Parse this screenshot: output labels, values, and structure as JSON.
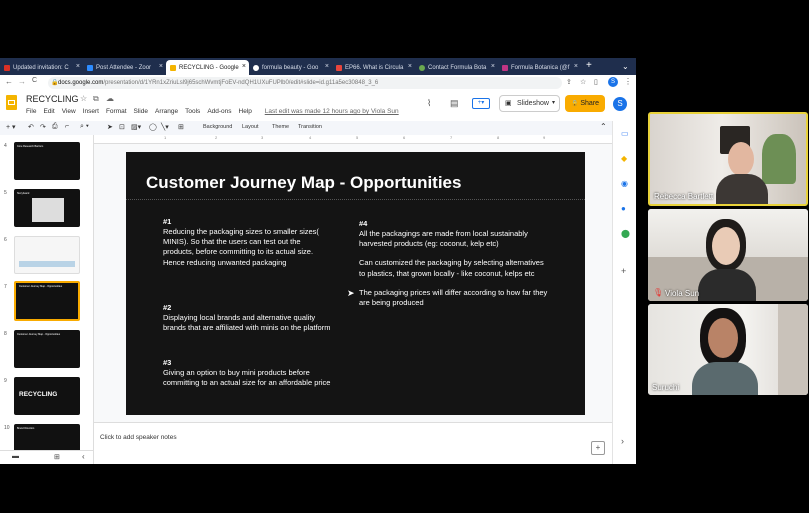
{
  "tabs": [
    {
      "label": "Updated invitation: C",
      "icon_color": "#d93025"
    },
    {
      "label": "Post Attendee - Zoor",
      "icon_color": "#2d8cff"
    },
    {
      "label": "RECYCLING - Google",
      "icon_color": "#f4b400",
      "active": true
    },
    {
      "label": "formula beauty - Goo",
      "icon_color": "#ffffff"
    },
    {
      "label": "EP66. What is Circula",
      "icon_color": "#e8453c"
    },
    {
      "label": "Contact Formula Bota",
      "icon_color": "#6aa84f"
    },
    {
      "label": "Formula Botanica (@f",
      "icon_color": "#c13584"
    }
  ],
  "new_tab_symbol": "+",
  "tab_close_symbol": "×",
  "nav": {
    "back": "←",
    "forward": "→",
    "reload": "C"
  },
  "address": {
    "url_host": "docs.google.com",
    "url_path": "/presentation/d/1YRn1xZriuLsl9j65schWvmtjFoEV-ndQH1UXuFUPlb0/edit#slide=id.g11a5ec30848_3_6"
  },
  "account_initial": "S",
  "doc": {
    "title": "RECYCLING",
    "menu": [
      "File",
      "Edit",
      "View",
      "Insert",
      "Format",
      "Slide",
      "Arrange",
      "Tools",
      "Add-ons",
      "Help"
    ],
    "last_edit": "Last edit was made 12 hours ago by Viola Sun",
    "slideshow_label": "Slideshow",
    "share_label": "Share",
    "share_icon": "lock-icon",
    "accent": "#f9ab00"
  },
  "toolbar": {
    "background": "Background",
    "layout": "Layout",
    "theme": "Theme",
    "transition": "Transition"
  },
  "filmstrip": [
    {
      "num": "4",
      "title": "Core Research Barriers"
    },
    {
      "num": "5",
      "title": "Storyboard"
    },
    {
      "num": "6",
      "title": ""
    },
    {
      "num": "7",
      "title": "Customer Journey Map - Opportunities",
      "selected": true
    },
    {
      "num": "8",
      "title": "Customer Journey Map - Opportunities"
    },
    {
      "num": "9",
      "title": "RECYCLING"
    },
    {
      "num": "10",
      "title": "Brand Direction"
    }
  ],
  "slide": {
    "title": "Customer Journey Map - Opportunities",
    "items_left": [
      {
        "num": "#1",
        "text": "Reducing the packaging sizes to smaller sizes( MINIS). So that the users can test out the products, before committing to its actual size. Hence reducing unwanted packaging"
      },
      {
        "num": "#2",
        "text": "Displaying local brands and alternative quality brands that are affiliated with minis on the platform"
      },
      {
        "num": "#3",
        "text": "Giving an option to buy mini products before committing to an actual size for an affordable price"
      }
    ],
    "items_right": {
      "num": "#4",
      "paras": [
        "All the packagings are made from local sustainably harvested products (eg: coconut, kelp etc)",
        "Can customized the packaging by selecting alternatives to plastics, that grown locally  - like coconut, kelps etc",
        "The packaging prices will differ according to how far they are being produced"
      ]
    }
  },
  "speaker_notes": "Click to add speaker notes",
  "participants": [
    {
      "name": "Rebecca Bartlett",
      "muted": false
    },
    {
      "name": "Viola Sun",
      "muted": true
    },
    {
      "name": "Suruchi",
      "muted": false
    }
  ]
}
